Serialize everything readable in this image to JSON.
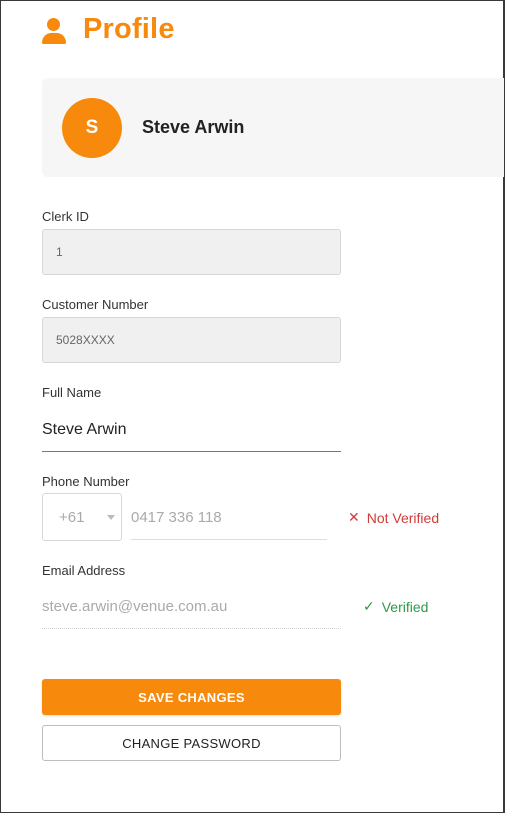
{
  "colors": {
    "accent": "#f7890c",
    "error": "#d33a3a",
    "success": "#2e9a45"
  },
  "header": {
    "icon": "person-icon",
    "title": "Profile"
  },
  "user": {
    "avatar_initial": "S",
    "name": "Steve Arwin"
  },
  "form": {
    "clerk_id": {
      "label": "Clerk ID",
      "value": "1"
    },
    "customer_number": {
      "label": "Customer Number",
      "value": "5028XXXX"
    },
    "full_name": {
      "label": "Full Name",
      "value": "Steve Arwin"
    },
    "phone": {
      "label": "Phone Number",
      "country_code": "+61",
      "value": "0417 336 118",
      "status_icon": "close-icon",
      "status": "Not Verified"
    },
    "email": {
      "label": "Email Address",
      "value": "steve.arwin@venue.com.au",
      "status_icon": "check-icon",
      "status": "Verified"
    }
  },
  "actions": {
    "save_label": "SAVE CHANGES",
    "change_password_label": "CHANGE PASSWORD"
  }
}
